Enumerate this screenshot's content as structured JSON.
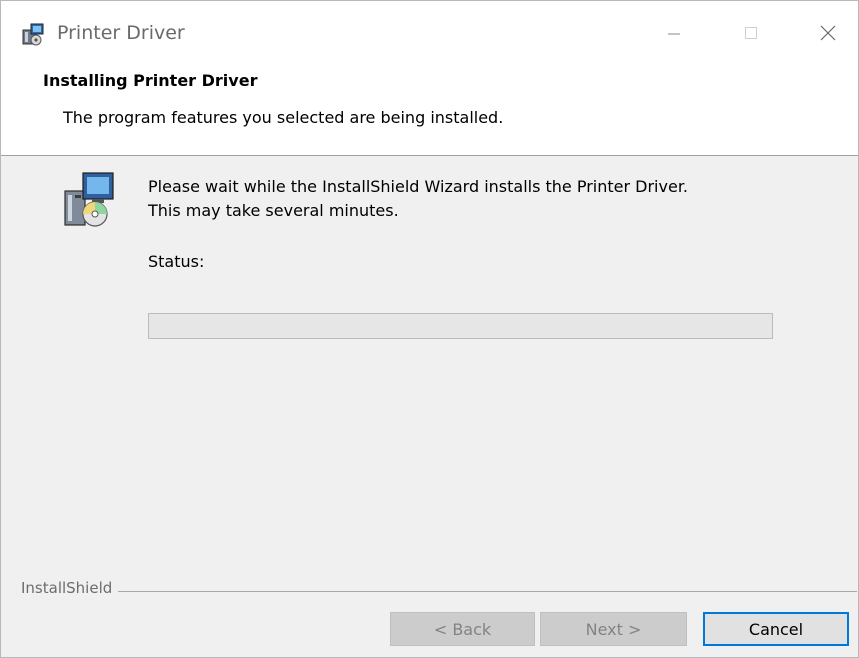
{
  "window": {
    "title": "Printer Driver",
    "app_icon": "installer-icon",
    "controls": {
      "minimize": "minimize-icon",
      "maximize": "maximize-icon",
      "close": "close-icon"
    }
  },
  "banner": {
    "title": "Installing Printer Driver",
    "subtitle": "The program features you selected are being installed."
  },
  "body": {
    "icon": "setup-computer-disc-icon",
    "message_line1": "Please wait while the InstallShield Wizard installs the Printer Driver.",
    "message_line2": "This may take several minutes.",
    "status_label": "Status:",
    "progress_percent": 0
  },
  "footer": {
    "brand": "InstallShield",
    "buttons": {
      "back": "< Back",
      "next": "Next >",
      "cancel": "Cancel"
    }
  },
  "colors": {
    "accent": "#0078d7",
    "progress_fill": "#06b025"
  }
}
